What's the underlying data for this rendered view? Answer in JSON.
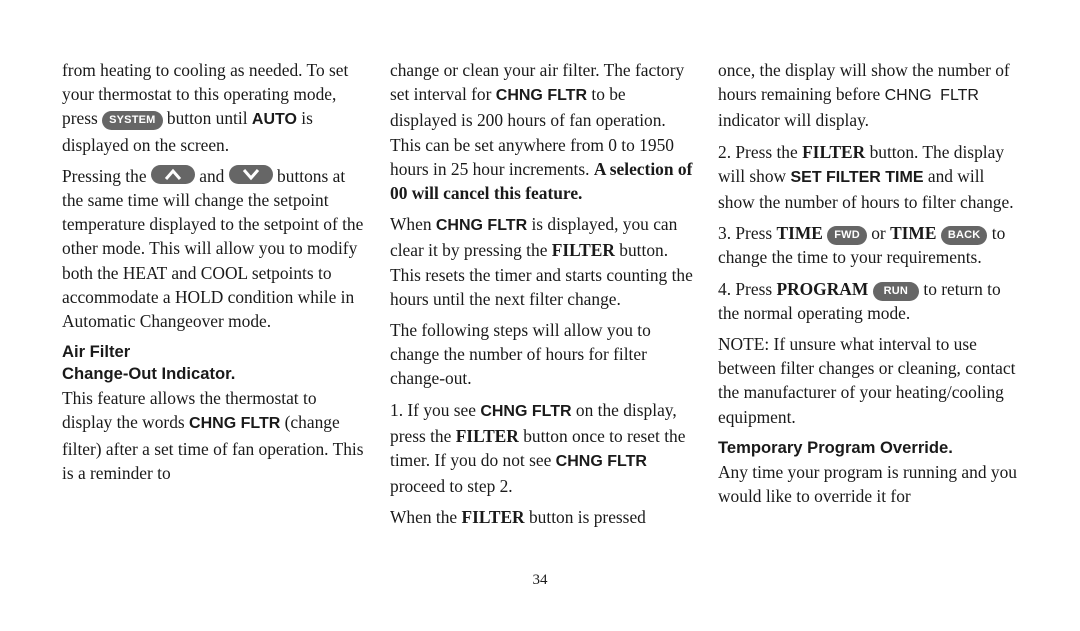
{
  "page": {
    "number": "34"
  },
  "col1": {
    "p1": {
      "t1": "from heating to cooling as needed. To set your thermostat to this operating mode, press ",
      "btn_system": "SYSTEM",
      "t2": " button until ",
      "auto": "AUTO",
      "t3": " is displayed on the screen."
    },
    "p2": {
      "t1": "Pressing the ",
      "t2": " and ",
      "t3": " buttons at the same time will change the setpoint temperature displayed to the setpoint of the other mode. This will allow you to modify both the HEAT and COOL setpoints to accommodate a HOLD condition while in Automatic Changeover mode."
    },
    "heading": {
      "line1": "Air Filter",
      "line2": "Change-Out Indicator."
    },
    "p3": {
      "t1": "This feature allows the thermostat to display the words ",
      "chng_fltr": "CHNG FLTR",
      "t2": " (change filter) after a set time of fan operation. This is a reminder to"
    }
  },
  "col2": {
    "p1": {
      "t1": "change or clean your air filter. The factory set interval for ",
      "chng_fltr": "CHNG FLTR",
      "t2": " to be displayed is 200 hours of fan operation. This can be set anywhere from 0 to 1950 hours in 25 hour increments. ",
      "bold": "A selection of 00 will cancel this feature."
    },
    "p2": {
      "t1": "When ",
      "chng_fltr": "CHNG FLTR",
      "t2": " is displayed, you can clear it by pressing the ",
      "filter": "FILTER",
      "t3": " button. This resets the timer and starts counting the hours until the next filter change."
    },
    "p3": "The following steps will allow you to change the number of hours for filter change-out.",
    "p4": {
      "t1": "1. If you see ",
      "chng_fltr": "CHNG FLTR",
      "t2": " on the display, press the ",
      "filter": "FILTER",
      "t3": " button once to reset the timer. If you do not see ",
      "chng_fltr2": "CHNG FLTR",
      "t4": " proceed to step 2."
    },
    "p5": {
      "t1": "When the ",
      "filter": "FILTER",
      "t2": " button is pressed"
    }
  },
  "col3": {
    "p1": {
      "t1": "once, the display will show the number of hours remaining before ",
      "chng_fltr": "CHNG FLTR",
      "t2": " indicator will display."
    },
    "p2": {
      "t1": "2. Press the ",
      "filter": "FILTER",
      "t2": " button. The display will show ",
      "set_filter_time": "SET FILTER TIME",
      "t3": " and will show the number of hours to filter change."
    },
    "p3": {
      "t1": "3. Press ",
      "time1": "TIME",
      "btn_fwd": "FWD",
      "t2": " or ",
      "time2": "TIME",
      "btn_back": "BACK",
      "t3": " to change the time to your requirements."
    },
    "p4": {
      "t1": "4. Press ",
      "program": "PROGRAM",
      "btn_run": "RUN",
      "t2": " to return to the normal operating mode."
    },
    "p5": "NOTE: If unsure what interval to use between filter changes or cleaning, contact the manufacturer of your heating/cooling equipment.",
    "heading": "Temporary Program Override.",
    "p6": "Any time your program is running and you would like to override it for"
  },
  "colors": {
    "button_bg": "#666666",
    "button_text": "#ffffff",
    "text": "#1a1a1a"
  }
}
